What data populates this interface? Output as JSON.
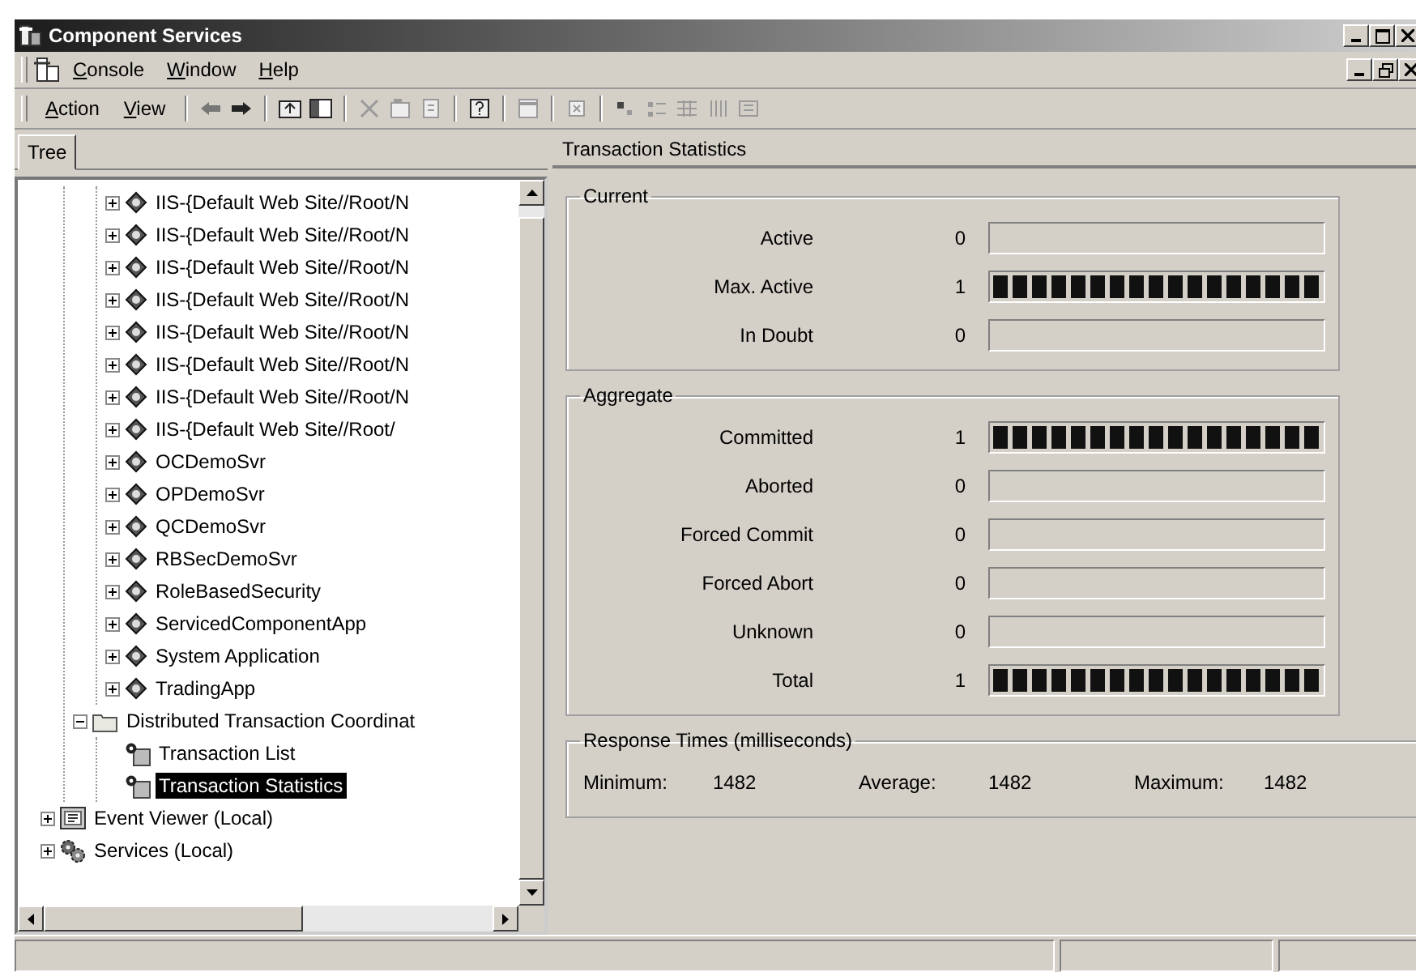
{
  "window": {
    "title": "Component Services"
  },
  "menu": [
    "Console",
    "Window",
    "Help"
  ],
  "toolbar": {
    "menus": [
      "Action",
      "View"
    ]
  },
  "tree_pane": {
    "tab": "Tree",
    "items": [
      {
        "children": [
          {
            "children": [
              {
                "label": "IIS-{Default Web Site//Root/N",
                "kind": "application",
                "expanded": false,
                "selected": false
              },
              {
                "label": "IIS-{Default Web Site//Root/N",
                "kind": "application",
                "expanded": false,
                "selected": false
              },
              {
                "label": "IIS-{Default Web Site//Root/N",
                "kind": "application",
                "expanded": false,
                "selected": false
              },
              {
                "label": "IIS-{Default Web Site//Root/N",
                "kind": "application",
                "expanded": false,
                "selected": false
              },
              {
                "label": "IIS-{Default Web Site//Root/N",
                "kind": "application",
                "expanded": false,
                "selected": false
              },
              {
                "label": "IIS-{Default Web Site//Root/N",
                "kind": "application",
                "expanded": false,
                "selected": false
              },
              {
                "label": "IIS-{Default Web Site//Root/N",
                "kind": "application",
                "expanded": false,
                "selected": false
              },
              {
                "label": "IIS-{Default Web Site//Root/",
                "kind": "application",
                "expanded": false,
                "selected": false
              },
              {
                "label": "OCDemoSvr",
                "kind": "application",
                "expanded": false,
                "selected": false
              },
              {
                "label": "OPDemoSvr",
                "kind": "application",
                "expanded": false,
                "selected": false
              },
              {
                "label": "QCDemoSvr",
                "kind": "application",
                "expanded": false,
                "selected": false
              },
              {
                "label": "RBSecDemoSvr",
                "kind": "application",
                "expanded": false,
                "selected": false
              },
              {
                "label": "RoleBasedSecurity",
                "kind": "application",
                "expanded": false,
                "selected": false
              },
              {
                "label": "ServicedComponentApp",
                "kind": "application",
                "expanded": false,
                "selected": false
              },
              {
                "label": "System Application",
                "kind": "application",
                "expanded": false,
                "selected": false
              },
              {
                "label": "TradingApp",
                "kind": "application",
                "expanded": false,
                "selected": false
              }
            ]
          },
          {
            "label": "Distributed Transaction Coordinat",
            "kind": "folder",
            "expanded": true,
            "selected": false,
            "children": [
              {
                "label": "Transaction List",
                "kind": "transaction",
                "selected": false
              },
              {
                "label": "Transaction Statistics",
                "kind": "transaction",
                "selected": true
              }
            ]
          }
        ]
      },
      {
        "label": "Event Viewer (Local)",
        "kind": "event-viewer",
        "expanded": false,
        "selected": false
      },
      {
        "label": "Services (Local)",
        "kind": "services",
        "expanded": false,
        "selected": false
      }
    ]
  },
  "detail_pane": {
    "title": "Transaction Statistics",
    "current": {
      "title": "Current",
      "rows": [
        {
          "label": "Active",
          "value": "0"
        },
        {
          "label": "Max. Active",
          "value": "1",
          "level": 1
        },
        {
          "label": "In Doubt",
          "value": "0"
        }
      ]
    },
    "aggregate": {
      "title": "Aggregate",
      "rows": [
        {
          "label": "Committed",
          "value": "1",
          "level": 1
        },
        {
          "label": "Aborted",
          "value": "0"
        },
        {
          "label": "Forced Commit",
          "value": "0"
        },
        {
          "label": "Forced Abort",
          "value": "0"
        },
        {
          "label": "Unknown",
          "value": "0"
        },
        {
          "label": "Total",
          "value": "1",
          "level": 1
        }
      ]
    },
    "response_times": {
      "title": "Response Times (milliseconds)",
      "items": [
        {
          "label": "Minimum:",
          "value": "1482"
        },
        {
          "label": "Average:",
          "value": "1482"
        },
        {
          "label": "Maximum:",
          "value": "1482"
        }
      ]
    }
  }
}
